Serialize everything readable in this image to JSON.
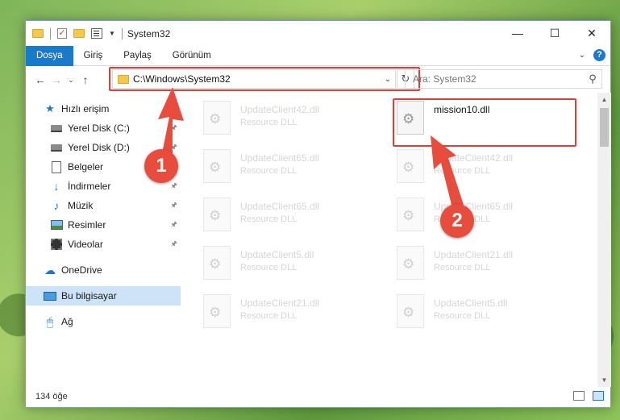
{
  "window": {
    "title": "System32"
  },
  "ribbon": {
    "tabs": [
      "Dosya",
      "Giriş",
      "Paylaş",
      "Görünüm"
    ],
    "active_tab": "Dosya"
  },
  "address": {
    "path": "C:\\Windows\\System32"
  },
  "search": {
    "placeholder": "Ara: System32"
  },
  "sidebar": {
    "items": [
      {
        "label": "Hızlı erişim",
        "icon": "star-icon"
      },
      {
        "label": "Yerel Disk (C:)",
        "icon": "drive-icon",
        "pinned": true
      },
      {
        "label": "Yerel Disk (D:)",
        "icon": "drive-icon",
        "pinned": true
      },
      {
        "label": "Belgeler",
        "icon": "document-icon",
        "pinned": true
      },
      {
        "label": "İndirmeler",
        "icon": "download-icon",
        "pinned": true
      },
      {
        "label": "Müzik",
        "icon": "music-icon",
        "pinned": true
      },
      {
        "label": "Resimler",
        "icon": "pictures-icon",
        "pinned": true
      },
      {
        "label": "Videolar",
        "icon": "video-icon",
        "pinned": true
      },
      {
        "label": "OneDrive",
        "icon": "cloud-icon"
      },
      {
        "label": "Bu bilgisayar",
        "icon": "computer-icon",
        "selected": true
      },
      {
        "label": "Ağ",
        "icon": "network-icon"
      }
    ]
  },
  "files": [
    {
      "name": "UpdateClient42.dll",
      "type": "Resource DLL",
      "faded": true
    },
    {
      "name": "mission10.dll",
      "type": "",
      "faded": false
    },
    {
      "name": "UpdateClient65.dll",
      "type": "Resource DLL",
      "faded": true
    },
    {
      "name": "UpdateClient42.dll",
      "type": "Resource DLL",
      "faded": true
    },
    {
      "name": "UpdateClient65.dll",
      "type": "Resource DLL",
      "faded": true
    },
    {
      "name": "UpdateClient65.dll",
      "type": "Resource DLL",
      "faded": true
    },
    {
      "name": "UpdateClient5.dll",
      "type": "Resource DLL",
      "faded": true
    },
    {
      "name": "UpdateClient21.dll",
      "type": "Resource DLL",
      "faded": true
    },
    {
      "name": "UpdateClient21.dll",
      "type": "Resource DLL",
      "faded": true
    },
    {
      "name": "UpdateClient5.dll",
      "type": "Resource DLL",
      "faded": true
    }
  ],
  "status": {
    "count": "134 öğe"
  },
  "annotations": {
    "step1": "1",
    "step2": "2",
    "color": "#e84c3d"
  }
}
